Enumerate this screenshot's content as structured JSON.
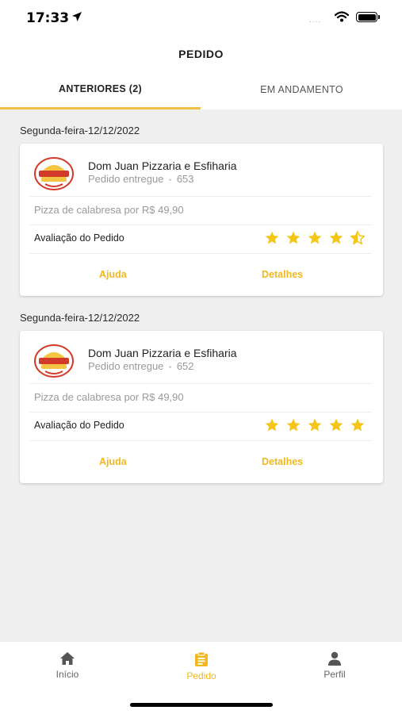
{
  "status_bar": {
    "time": "17:33",
    "signal_dots": "....",
    "icons": [
      "location-arrow-icon",
      "wifi-icon",
      "battery-icon"
    ]
  },
  "header": {
    "title": "PEDIDO"
  },
  "tabs": [
    {
      "label": "ANTERIORES (2)",
      "active": true
    },
    {
      "label": "EM ANDAMENTO",
      "active": false
    }
  ],
  "accent_color": "#f0b820",
  "orders": [
    {
      "date": "Segunda-feira-12/12/2022",
      "store": "Dom Juan Pizzaria e Esfiharia",
      "status": "Pedido entregue",
      "separator": "•",
      "order_number": "653",
      "item": "Pizza de calabresa por R$ 49,90",
      "rating_label": "Avaliação do Pedido",
      "rating": 4.5,
      "help_label": "Ajuda",
      "details_label": "Detalhes"
    },
    {
      "date": "Segunda-feira-12/12/2022",
      "store": "Dom Juan Pizzaria e Esfiharia",
      "status": "Pedido entregue",
      "separator": "•",
      "order_number": "652",
      "item": "Pizza de calabresa por R$ 49,90",
      "rating_label": "Avaliação do Pedido",
      "rating": 5,
      "help_label": "Ajuda",
      "details_label": "Detalhes"
    }
  ],
  "bottom_nav": [
    {
      "label": "Início",
      "icon": "home-icon",
      "active": false
    },
    {
      "label": "Pedido",
      "icon": "clipboard-icon",
      "active": true
    },
    {
      "label": "Perfil",
      "icon": "user-icon",
      "active": false
    }
  ]
}
